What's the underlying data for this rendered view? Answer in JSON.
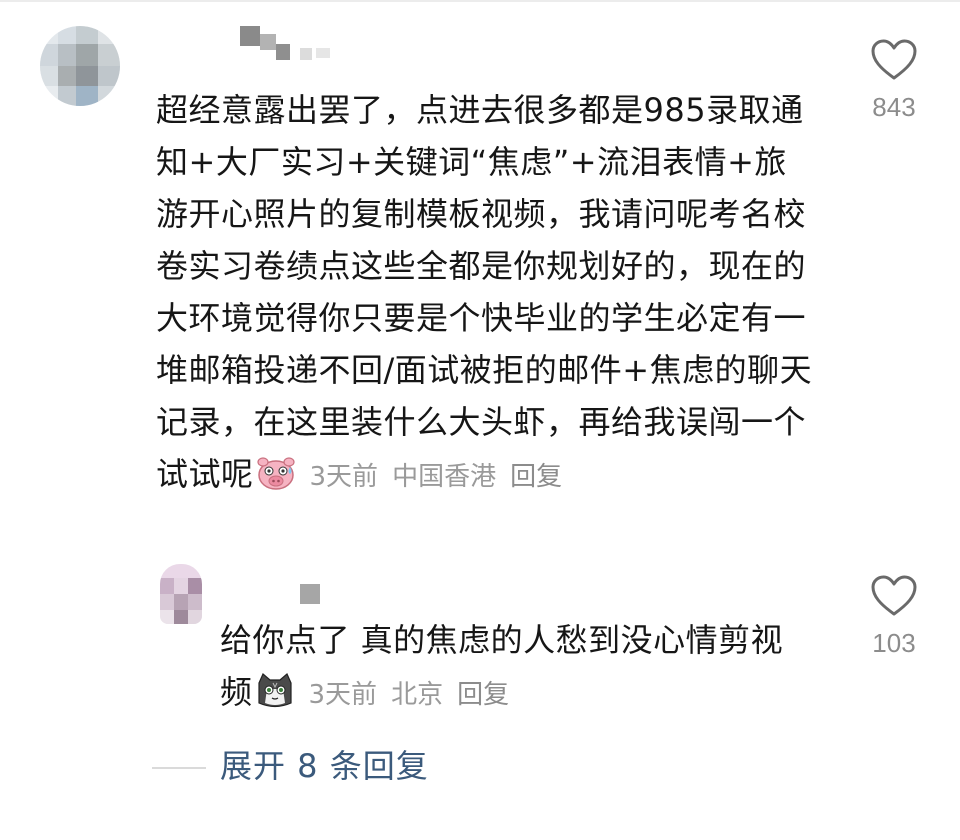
{
  "comment": {
    "text": "超经意露出罢了，点进去很多都是985录取通知+大厂实习+关键词“焦虑”+流泪表情+旅游开心照片的复制模板视频，我请问呢考名校卷实习卷绩点这些全都是你规划好的，现在的大环境觉得你只要是个快毕业的学生必定有一堆邮箱投递不回/面试被拒的邮件+焦虑的聊天记录，在这里装什么大头虾，再给我误闯一个试试呢",
    "time": "3天前",
    "location": "中国香港",
    "reply_label": "回复",
    "likes": "843",
    "emoji": "pig-sweat-emoji"
  },
  "reply": {
    "text": "给你点了 真的焦虑的人愁到没心情剪视频",
    "time": "3天前",
    "location": "北京",
    "reply_label": "回复",
    "likes": "103",
    "emoji": "cat-emoji"
  },
  "expand_replies": "展开 8 条回复",
  "colors": {
    "text": "#161616",
    "meta": "#9a9a9a",
    "link": "#3b5a7c"
  }
}
